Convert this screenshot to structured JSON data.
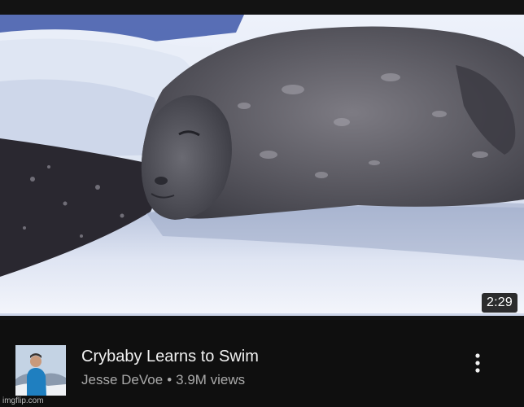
{
  "video": {
    "duration": "2:29",
    "title": "Crybaby Learns to Swim",
    "channel": "Jesse DeVoe",
    "separator": "•",
    "views": "3.9M views"
  },
  "thumbnail": {
    "subject": "seal-on-ice",
    "colors": {
      "ice": "#dfe6f2",
      "shadow": "#9aa7c2",
      "water": "#26242c",
      "seal": "#4a4a52"
    }
  },
  "icons": {
    "menu": "more-vertical-icon"
  },
  "watermark": "imgflip.com"
}
